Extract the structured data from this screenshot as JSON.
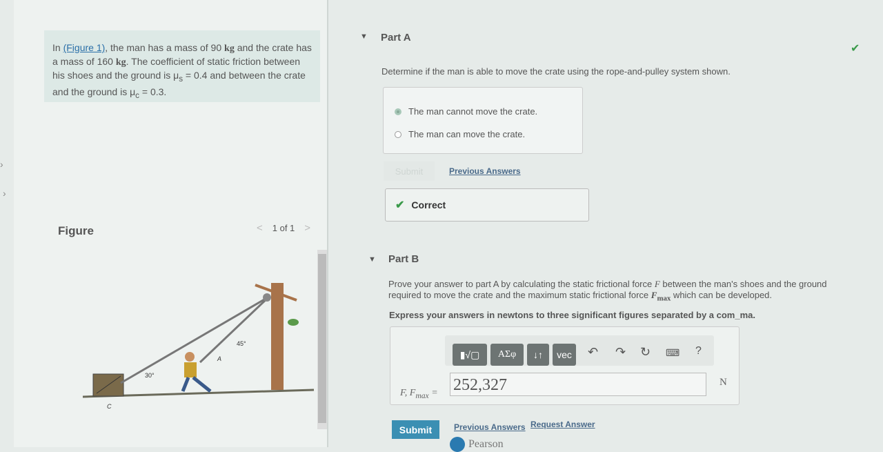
{
  "problem": {
    "pre": "In ",
    "link": "(Figure 1)",
    "text1": ", the man has a mass of 90 ",
    "kg1": "kg",
    "text2": " and the crate has a mass of 160 ",
    "kg2": "kg",
    "text3": ". The coefficient of static friction between his shoes and the ground is μ",
    "sub_s": "s",
    "text4": " = 0.4 and between the crate and the ground is μ",
    "sub_c": "c",
    "text5": " = 0.3."
  },
  "figure": {
    "title": "Figure",
    "pager": "1 of 1",
    "prev": "<",
    "next": ">",
    "labels": {
      "a30": "30°",
      "a45": "45°",
      "A": "A",
      "C": "C"
    }
  },
  "partA": {
    "title": "Part A",
    "question": "Determine if the man is able to move the crate using the rope-and-pulley system shown.",
    "options": [
      {
        "label": "The man cannot move the crate.",
        "selected": true
      },
      {
        "label": "The man can move the crate.",
        "selected": false
      }
    ],
    "submit": "Submit",
    "previous": "Previous Answers",
    "feedback": "Correct",
    "check": "✔"
  },
  "partB": {
    "title": "Part B",
    "question1": "Prove your answer to part A by calculating the static frictional force ",
    "F": "F",
    "question2": " between the man's shoes and the ground required to move the crate and the maximum static frictional force ",
    "Fmax": "F",
    "Fmax_sub": "max",
    "question3": " which can be developed.",
    "instruction": "Express your answers in newtons to three significant figures separated by a com_ma.",
    "toolbar": {
      "templates": "▮√▢",
      "greek": "ΑΣφ",
      "arrows": "↓↑",
      "vec": "vec",
      "help": "?"
    },
    "var_label": "F, F",
    "var_sub": "max",
    "equals": "=",
    "value": "252,327",
    "unit": "N",
    "submit": "Submit",
    "previous": "Previous Answers",
    "request": "Request Answer"
  },
  "footer": {
    "brand": "Pearson"
  },
  "colors": {
    "accent": "#3b8fb3",
    "correct": "#3a9a4a"
  }
}
